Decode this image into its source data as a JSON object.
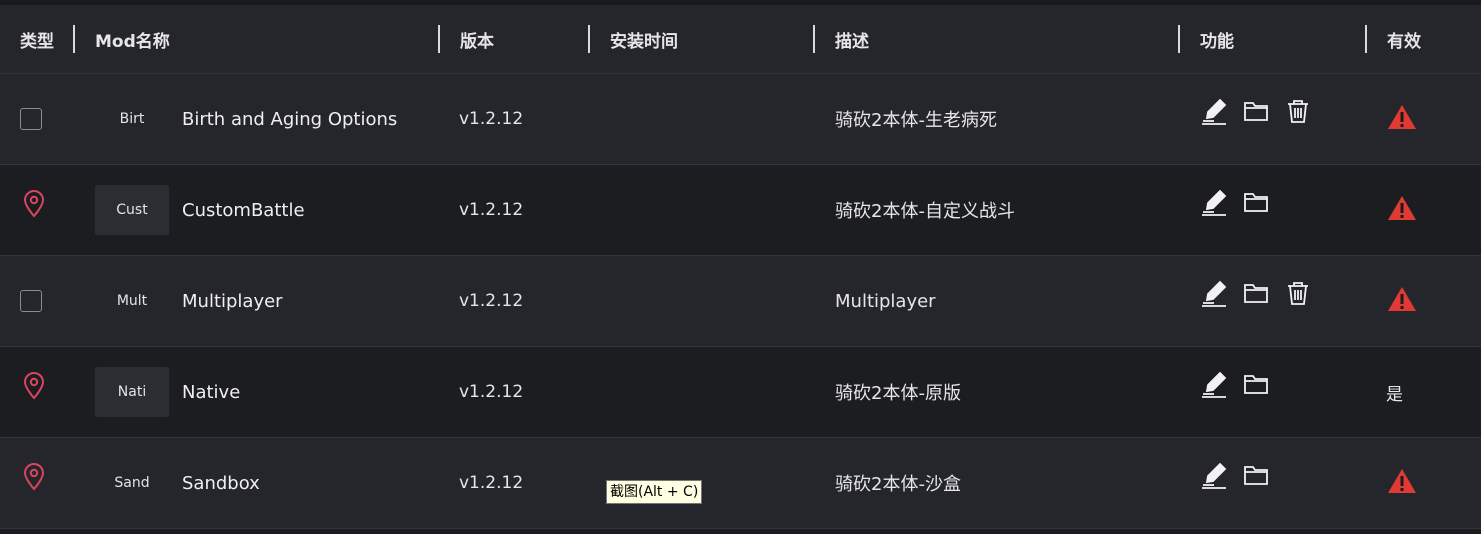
{
  "header": {
    "type": "类型",
    "name": "Mod名称",
    "version": "版本",
    "install_time": "安装时间",
    "description": "描述",
    "functions": "功能",
    "valid": "有效"
  },
  "rows": [
    {
      "type_icon": "checkbox",
      "thumb": "Birt",
      "name": "Birth and Aging Options",
      "version": "v1.2.12",
      "install_time": "",
      "description": "骑砍2本体-生老病死",
      "can_delete": true,
      "valid": "warning-icon"
    },
    {
      "type_icon": "location-pin-icon",
      "thumb": "Cust",
      "name": "CustomBattle",
      "version": "v1.2.12",
      "install_time": "",
      "description": "骑砍2本体-自定义战斗",
      "can_delete": false,
      "valid": "warning-icon"
    },
    {
      "type_icon": "checkbox",
      "thumb": "Mult",
      "name": "Multiplayer",
      "version": "v1.2.12",
      "install_time": "",
      "description": "Multiplayer",
      "can_delete": true,
      "valid": "warning-icon"
    },
    {
      "type_icon": "location-pin-icon",
      "thumb": "Nati",
      "name": "Native",
      "version": "v1.2.12",
      "install_time": "",
      "description": "骑砍2本体-原版",
      "can_delete": false,
      "valid_text": "是"
    },
    {
      "type_icon": "location-pin-icon",
      "thumb": "Sand",
      "name": "Sandbox",
      "version": "v1.2.12",
      "install_time": "",
      "description": "骑砍2本体-沙盒",
      "can_delete": false,
      "valid": "warning-icon"
    }
  ],
  "tooltip": "截图(Alt + C)",
  "colors": {
    "pin": "#d9455f",
    "warning": "#e03a35",
    "header_bg": "#25262b",
    "row_alt_bg": "#1c1d21"
  }
}
